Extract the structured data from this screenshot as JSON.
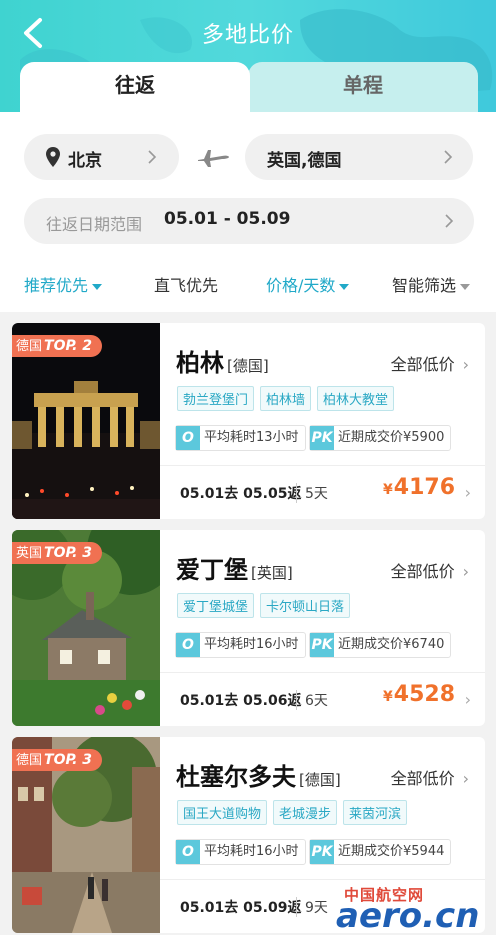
{
  "header": {
    "title": "多地比价",
    "tab_round": "往返",
    "tab_oneway": "单程"
  },
  "search": {
    "from": "北京",
    "to": "英国,德国",
    "date_label": "往返日期范围",
    "date_value": "05.01 - 05.09"
  },
  "filters": [
    "推荐优先",
    "直飞优先",
    "价格/天数",
    "智能筛选"
  ],
  "cards": [
    {
      "badge_country": "德国",
      "badge_rank": "TOP. 2",
      "city": "柏林",
      "country": "[德国]",
      "low_price": "全部低价",
      "tags": [
        "勃兰登堡门",
        "柏林墙",
        "柏林大教堂"
      ],
      "avg_time": "平均耗时13小时",
      "recent_price": "近期成交价¥5900",
      "dates": "05.01去 05.05返",
      "days": "5天",
      "currency": "¥",
      "price": "4176"
    },
    {
      "badge_country": "英国",
      "badge_rank": "TOP. 3",
      "city": "爱丁堡",
      "country": "[英国]",
      "low_price": "全部低价",
      "tags": [
        "爱丁堡城堡",
        "卡尔顿山日落"
      ],
      "avg_time": "平均耗时16小时",
      "recent_price": "近期成交价¥6740",
      "dates": "05.01去 05.06返",
      "days": "6天",
      "currency": "¥",
      "price": "4528"
    },
    {
      "badge_country": "德国",
      "badge_rank": "TOP. 3",
      "city": "杜塞尔多夫",
      "country": "[德国]",
      "low_price": "全部低价",
      "tags": [
        "国王大道购物",
        "老城漫步",
        "莱茵河滨"
      ],
      "avg_time": "平均耗时16小时",
      "recent_price": "近期成交价¥5944",
      "dates": "05.01去 05.09返",
      "days": "9天",
      "currency": "¥",
      "price": ""
    }
  ],
  "icons": {
    "clock": "O",
    "pk": "PK"
  },
  "watermark": {
    "cn": "中国航空网",
    "en": "aero.cn"
  },
  "colors": {
    "accent": "#21a9c8",
    "header": "#45d4d6",
    "price": "#f0712b",
    "badge": "#f07152"
  }
}
